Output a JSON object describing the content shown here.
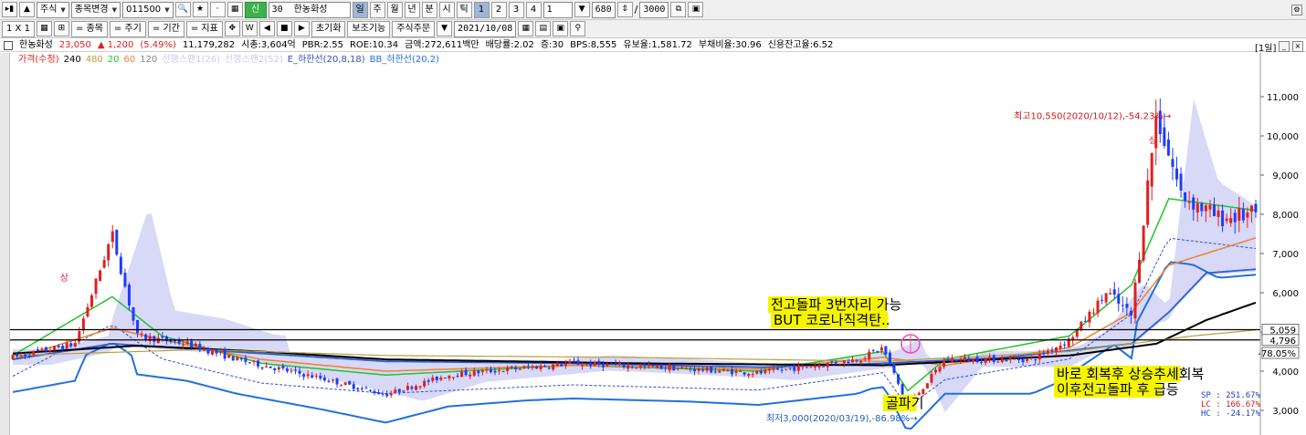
{
  "toolbar1": {
    "market": "주식",
    "stock_change": "종목변경",
    "code": "011500",
    "stock_id": "30",
    "stock_name": "한농화성",
    "periods": [
      "일",
      "주",
      "월",
      "년",
      "분",
      "시",
      "틱"
    ],
    "counts": [
      "1",
      "2",
      "3",
      "4"
    ],
    "count_value": "1",
    "bars_value": "680",
    "bars_total": "3000"
  },
  "toolbar2": {
    "grid_label": "1 X 1",
    "btn_stock": "종목",
    "btn_cycle": "주기",
    "btn_period": "기간",
    "btn_indicator": "지표",
    "btn_reset": "초기화",
    "btn_aux": "보조기능",
    "btn_order": "주식주문",
    "date": "2021/10/08"
  },
  "info": {
    "name": "한농화성",
    "price": "23,050",
    "change": "▲  1,200",
    "change_pct": "(5.49%)",
    "volume": "11,179,282",
    "mktcap": "시총:3,604억",
    "per": "PBR:2.55",
    "roe": "ROE:10.34",
    "amount": "금액:272,611백만",
    "dividend": "배당률:2.02",
    "margin": "증:30",
    "bps": "BPS:8,555",
    "reserve": "유보율:1,581.72",
    "debt": "부채비율:30.96",
    "credit": "신용잔고율:6.52",
    "period_tag": "[1일]"
  },
  "legend": {
    "price": "가격(수정)",
    "ma240": "240",
    "ma480": "480",
    "ma20": "20",
    "ma60": "60",
    "ma120": "120",
    "span1": "선행스팬1(26)",
    "span2": "선행스팬2(52)",
    "env": "E_하한선(20,8,18)",
    "bb": "BB_하한선(20,2)"
  },
  "colors": {
    "up": "#e02020",
    "down": "#1f3cff",
    "ma20": "#22c42a",
    "ma60": "#f08030",
    "ma120": "#2a60d0",
    "ma240": "#000000",
    "ma480": "#b8a040",
    "cloud": "#b8b8f0",
    "bb_lower": "#2070e0",
    "env_lower": "#3050c0",
    "highlight": "#f5f500",
    "marker": "#ff40c0"
  },
  "chart_data": {
    "type": "candlestick",
    "ylim": [
      2600,
      11600
    ],
    "yticks": [
      3000,
      4000,
      5000,
      6000,
      7000,
      8000,
      9000,
      10000,
      11000
    ],
    "ytick_labels": [
      "3,000",
      "4,000",
      "5,000",
      "6,000",
      "7,000",
      "8,000",
      "9,000",
      "10,000",
      "11,000"
    ],
    "grid": false,
    "high_label": "최고10,550(2020/10/12),-54.23%",
    "high_value": 10550,
    "low_label": "최저3,000(2020/03/19),-86.98%",
    "low_value": 3000,
    "hlines": [
      5059,
      4796
    ],
    "right_labels": [
      "5,059",
      "4,796",
      "-78.05%"
    ],
    "annotations": [
      "전고돌파 3번자리 가능",
      "BUT 코로나직격탄..",
      "골파기",
      "바로 회복후 상승추세회복",
      "이후전고돌파 후 급등"
    ],
    "stats": [
      "SP : 251.67%",
      "LC : 166.67%",
      "HC : -24.17%"
    ],
    "markers": [
      "상",
      "상"
    ],
    "price_path": [
      [
        0,
        4350
      ],
      [
        0.05,
        4700
      ],
      [
        0.08,
        7500
      ],
      [
        0.1,
        4900
      ],
      [
        0.14,
        4700
      ],
      [
        0.18,
        4300
      ],
      [
        0.25,
        3800
      ],
      [
        0.3,
        3400
      ],
      [
        0.35,
        3900
      ],
      [
        0.45,
        4200
      ],
      [
        0.52,
        4100
      ],
      [
        0.6,
        3950
      ],
      [
        0.68,
        4300
      ],
      [
        0.7,
        4600
      ],
      [
        0.72,
        3100
      ],
      [
        0.75,
        4300
      ],
      [
        0.82,
        4300
      ],
      [
        0.85,
        4800
      ],
      [
        0.88,
        6000
      ],
      [
        0.9,
        5400
      ],
      [
        0.92,
        10550
      ],
      [
        0.94,
        8500
      ],
      [
        0.97,
        7900
      ],
      [
        1.0,
        8000
      ]
    ],
    "series": [
      {
        "name": "20",
        "path": [
          [
            0,
            4400
          ],
          [
            0.08,
            5900
          ],
          [
            0.12,
            4900
          ],
          [
            0.2,
            4200
          ],
          [
            0.3,
            3900
          ],
          [
            0.45,
            4150
          ],
          [
            0.6,
            4000
          ],
          [
            0.7,
            4500
          ],
          [
            0.72,
            3500
          ],
          [
            0.75,
            4300
          ],
          [
            0.85,
            4900
          ],
          [
            0.9,
            6200
          ],
          [
            0.93,
            8400
          ],
          [
            1.0,
            8100
          ]
        ]
      },
      {
        "name": "60",
        "path": [
          [
            0,
            4300
          ],
          [
            0.08,
            5100
          ],
          [
            0.12,
            4800
          ],
          [
            0.2,
            4300
          ],
          [
            0.3,
            4000
          ],
          [
            0.45,
            4150
          ],
          [
            0.6,
            4050
          ],
          [
            0.7,
            4350
          ],
          [
            0.75,
            4150
          ],
          [
            0.85,
            4600
          ],
          [
            0.9,
            5500
          ],
          [
            0.93,
            6700
          ],
          [
            1.0,
            7400
          ]
        ]
      },
      {
        "name": "120",
        "path": [
          [
            0,
            4300
          ],
          [
            0.08,
            4700
          ],
          [
            0.15,
            4550
          ],
          [
            0.3,
            4250
          ],
          [
            0.45,
            4200
          ],
          [
            0.6,
            4100
          ],
          [
            0.7,
            4200
          ],
          [
            0.8,
            4350
          ],
          [
            0.9,
            4700
          ],
          [
            0.93,
            5500
          ],
          [
            0.96,
            6500
          ],
          [
            1.0,
            6600
          ]
        ]
      },
      {
        "name": "240",
        "path": [
          [
            0,
            4450
          ],
          [
            0.1,
            4650
          ],
          [
            0.2,
            4500
          ],
          [
            0.3,
            4300
          ],
          [
            0.5,
            4200
          ],
          [
            0.7,
            4150
          ],
          [
            0.85,
            4400
          ],
          [
            0.92,
            4700
          ],
          [
            0.96,
            5300
          ],
          [
            1.0,
            5750
          ]
        ]
      },
      {
        "name": "480",
        "path": [
          [
            0,
            4400
          ],
          [
            0.15,
            4550
          ],
          [
            0.3,
            4400
          ],
          [
            0.5,
            4350
          ],
          [
            0.7,
            4250
          ],
          [
            0.85,
            4500
          ],
          [
            0.95,
            4900
          ],
          [
            1.0,
            5050
          ]
        ]
      }
    ]
  }
}
